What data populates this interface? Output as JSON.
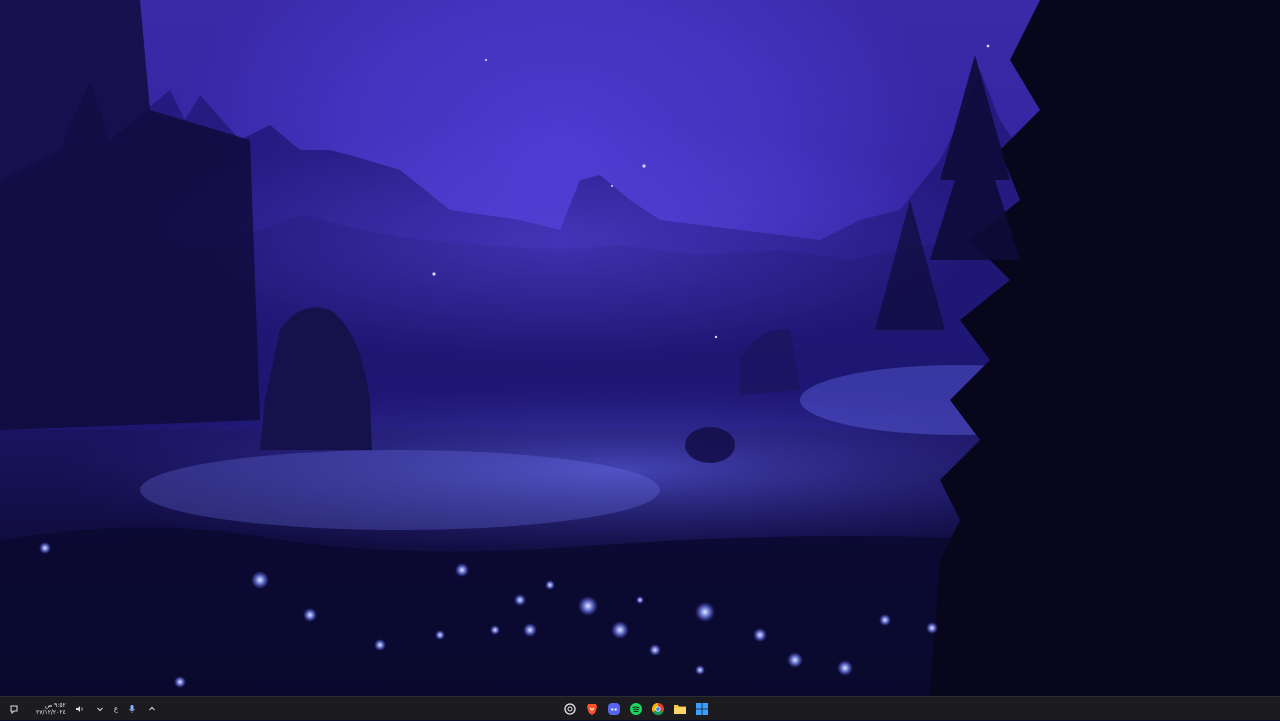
{
  "taskbar": {
    "clock_time": "٩:٥٢ ص",
    "clock_date": "٢٧/١٢/٢٠٢٤",
    "language_indicator": "ع",
    "tray_icons": [
      "notification-icon",
      "volume-icon",
      "chevron-down-icon",
      "microphone-icon",
      "chevron-up-icon"
    ],
    "pinned_apps": [
      {
        "name": "openai-app",
        "icon": "openai-icon"
      },
      {
        "name": "brave-browser",
        "icon": "brave-icon"
      },
      {
        "name": "discord",
        "icon": "discord-icon"
      },
      {
        "name": "spotify",
        "icon": "spotify-icon"
      },
      {
        "name": "chrome",
        "icon": "chrome-icon"
      },
      {
        "name": "file-explorer",
        "icon": "folder-icon"
      },
      {
        "name": "start",
        "icon": "windows-icon"
      }
    ]
  },
  "wallpaper": {
    "scene": "misty purple night forest with glowing flowers"
  },
  "colors": {
    "sky": "#3a2aa8",
    "glow_flower": "#8fa0ff",
    "taskbar_bg": "#1b1b20",
    "spotify": "#1ed760",
    "brave": "#fb542b",
    "discord": "#5865f2"
  }
}
